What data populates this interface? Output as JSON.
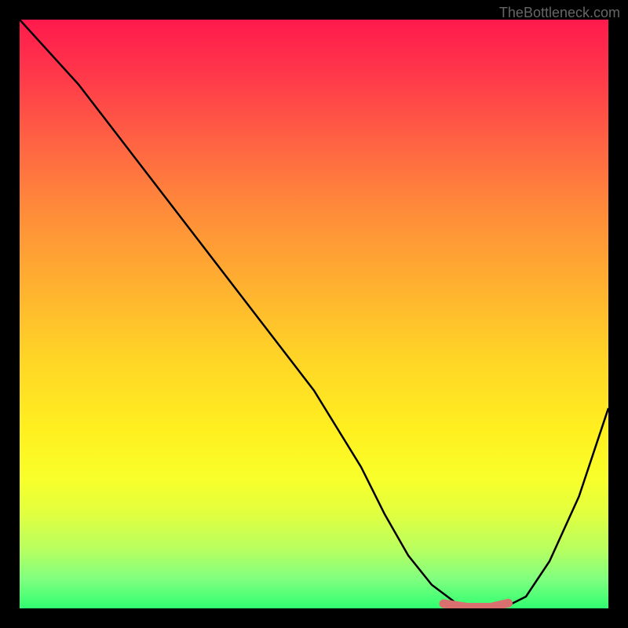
{
  "watermark": "TheBottleneck.com",
  "chart_data": {
    "type": "line",
    "title": "",
    "xlabel": "",
    "ylabel": "",
    "xlim": [
      0,
      100
    ],
    "ylim": [
      0,
      100
    ],
    "series": [
      {
        "name": "bottleneck-curve",
        "color": "#000000",
        "x": [
          0,
          10,
          20,
          30,
          40,
          50,
          58,
          62,
          66,
          70,
          74,
          78,
          82,
          86,
          90,
          95,
          100
        ],
        "values": [
          100,
          89,
          76,
          63,
          50,
          37,
          24,
          16,
          9,
          4,
          1,
          0,
          0,
          2,
          8,
          19,
          34
        ]
      },
      {
        "name": "optimal-range-marker",
        "color": "#d9706f",
        "x": [
          72,
          76,
          80,
          83
        ],
        "values": [
          0.8,
          0.2,
          0.2,
          0.9
        ]
      }
    ],
    "background_gradient": {
      "top": "#ff1a4d",
      "mid": "#ffd626",
      "bottom": "#30ff70"
    }
  }
}
